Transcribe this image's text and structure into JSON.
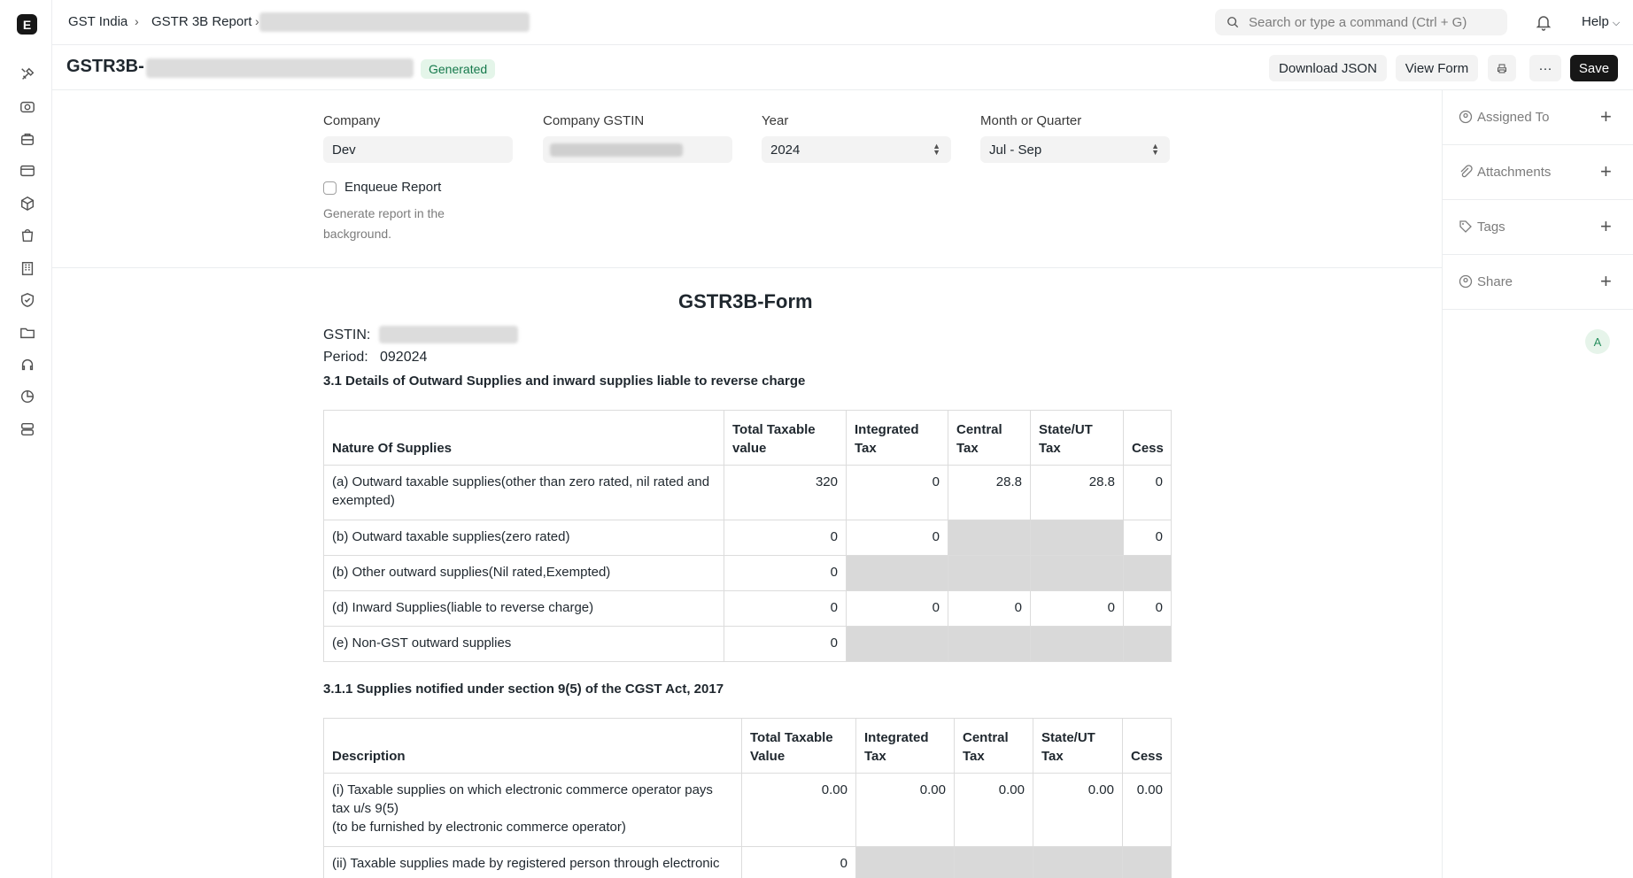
{
  "app": {
    "logo_letter": "E"
  },
  "rail_icons": [
    "tools-icon",
    "webcam-icon",
    "briefcase-icon",
    "card-icon",
    "box-icon",
    "bag-icon",
    "building-icon",
    "shield-icon",
    "folder-icon",
    "headset-icon",
    "chart-icon",
    "server-icon"
  ],
  "breadcrumbs": [
    "GST India",
    "GSTR 3B Report"
  ],
  "search": {
    "placeholder": "Search or type a command (Ctrl + G)"
  },
  "navbar": {
    "help_label": "Help",
    "avatar_letter": "A"
  },
  "page": {
    "title_prefix": "GSTR3B-",
    "status": "Generated",
    "buttons": {
      "download_json": "Download JSON",
      "view_form": "View Form",
      "more": "···",
      "save": "Save"
    }
  },
  "form": {
    "company": {
      "label": "Company",
      "value": "Dev"
    },
    "company_gstin": {
      "label": "Company GSTIN"
    },
    "year": {
      "label": "Year",
      "value": "2024"
    },
    "month_or_quarter": {
      "label": "Month or Quarter",
      "value": "Jul - Sep"
    },
    "enqueue": {
      "label": "Enqueue Report",
      "description": "Generate report in the background.",
      "checked": false
    }
  },
  "sidebar": {
    "items": [
      {
        "label": "Assigned To",
        "icon": "assign-icon"
      },
      {
        "label": "Attachments",
        "icon": "paperclip-icon"
      },
      {
        "label": "Tags",
        "icon": "tag-icon"
      },
      {
        "label": "Share",
        "icon": "share-icon"
      }
    ],
    "avatar_letter": "A"
  },
  "report": {
    "title": "GSTR3B-Form",
    "gstin_label": "GSTIN:",
    "period_label": "Period:",
    "period_value": "092024",
    "section_31": {
      "title": "3.1  Details of Outward Supplies and inward supplies liable to reverse charge",
      "headers": [
        "Nature Of Supplies",
        "Total Taxable value",
        "Integrated Tax",
        "Central Tax",
        "State/UT Tax",
        "Cess"
      ],
      "rows": [
        [
          "(a) Outward taxable supplies(other than zero rated, nil rated and exempted)",
          "320",
          "0",
          "28.8",
          "28.8",
          "0"
        ],
        [
          "(b) Outward taxable supplies(zero rated)",
          "0",
          "0",
          "",
          "",
          "0"
        ],
        [
          "(b) Other outward supplies(Nil rated,Exempted)",
          "0",
          "",
          "",
          "",
          ""
        ],
        [
          "(d) Inward Supplies(liable to reverse charge)",
          "0",
          "0",
          "0",
          "0",
          "0"
        ],
        [
          "(e) Non-GST outward supplies",
          "0",
          "",
          "",
          "",
          ""
        ]
      ]
    },
    "section_311": {
      "title": "3.1.1  Supplies notified under section 9(5) of the CGST Act, 2017",
      "headers": [
        "Description",
        "Total Taxable Value",
        "Integrated Tax",
        "Central Tax",
        "State/UT Tax",
        "Cess"
      ],
      "rows": [
        [
          "(i) Taxable supplies on which electronic commerce operator pays tax u/s 9(5)",
          "(to be furnished by electronic commerce operator)",
          "0.00",
          "0.00",
          "0.00",
          "0.00",
          "0.00"
        ],
        [
          "(ii) Taxable supplies made by registered person through electronic",
          "0"
        ]
      ]
    }
  }
}
